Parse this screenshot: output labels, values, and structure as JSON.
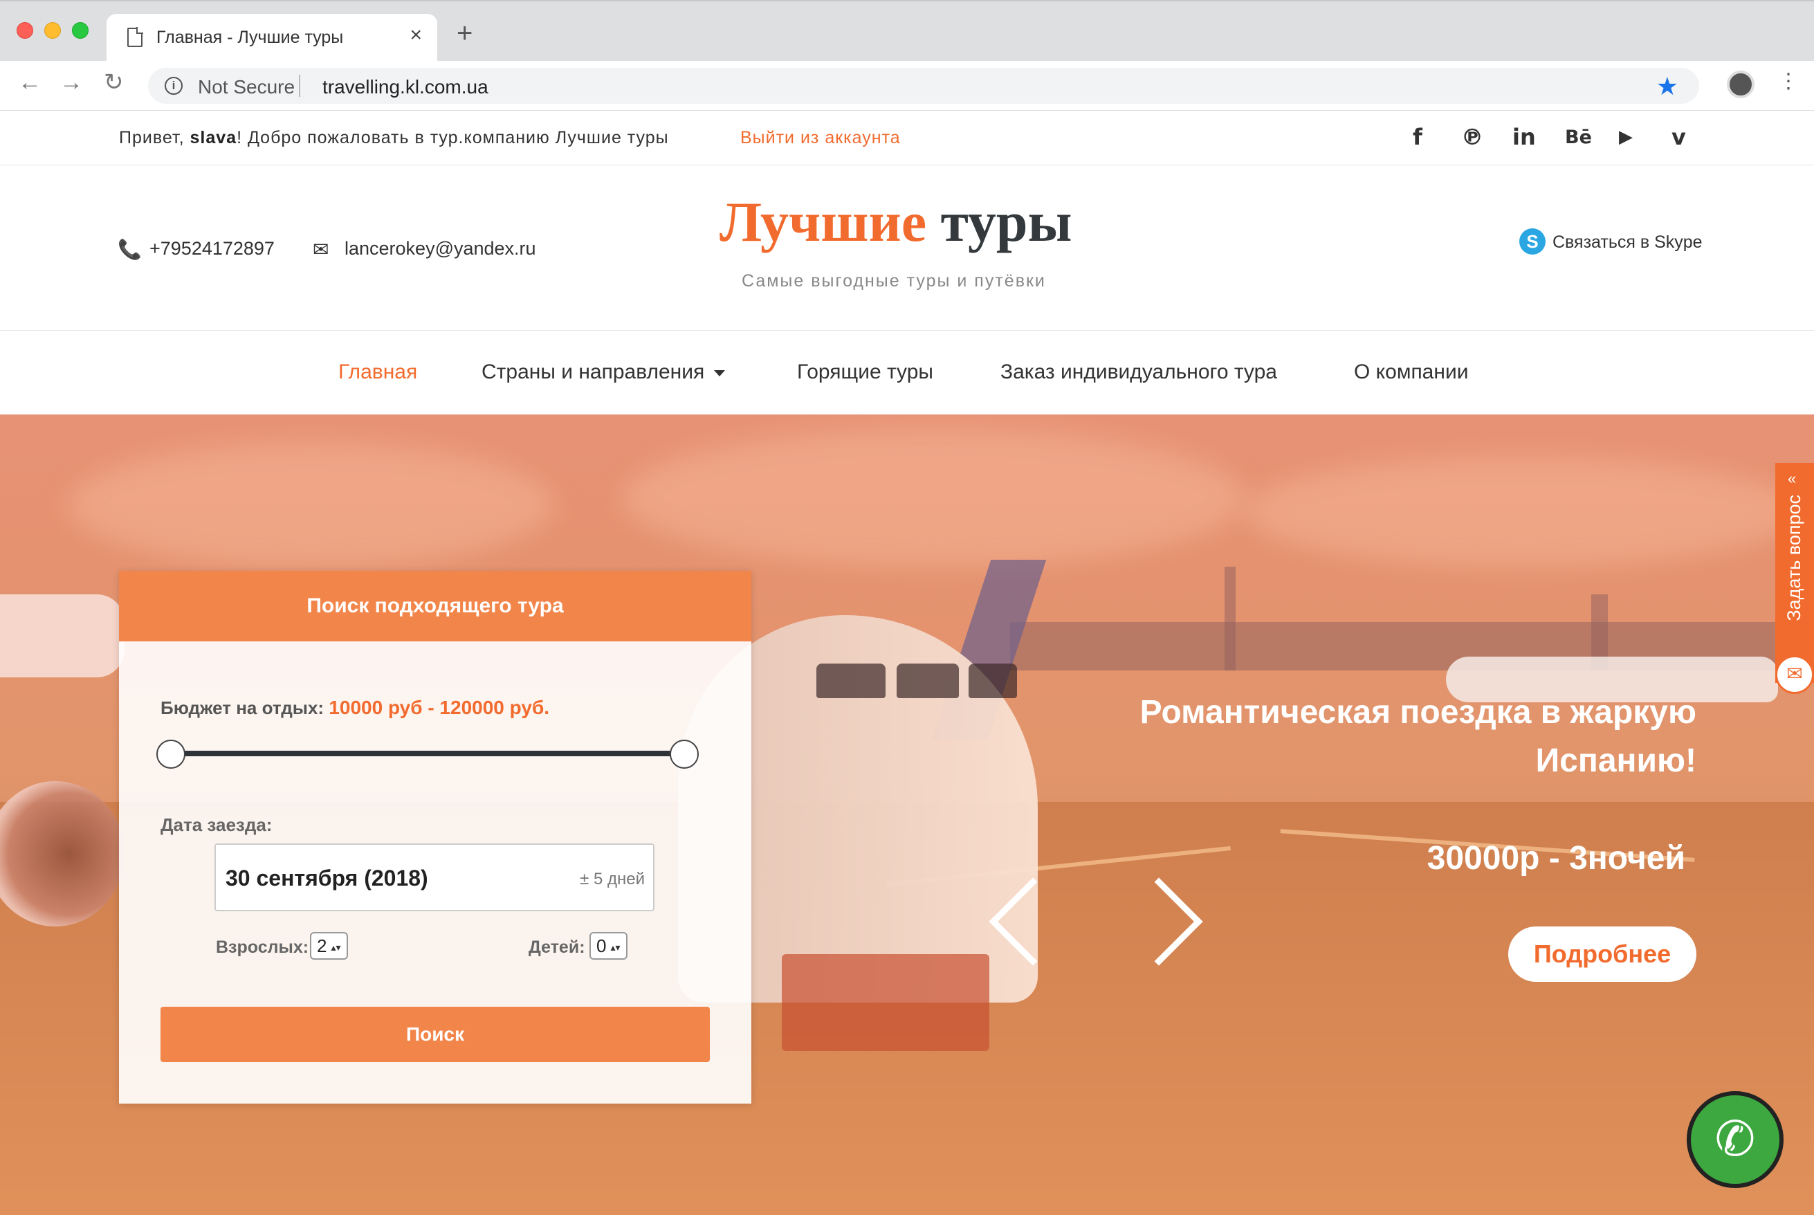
{
  "browser": {
    "tab_title": "Главная - Лучшие туры",
    "tab_close": "×",
    "new_tab": "+",
    "back": "←",
    "forward": "→",
    "reload": "↻",
    "security_label": "Not Secure",
    "url": "travelling.kl.com.ua",
    "bookmark_star": "★",
    "menu": "⋮",
    "info": "i"
  },
  "topbar": {
    "greeting_prefix": "Привет,",
    "username": "slava",
    "greeting_suffix": "! Добро пожаловать в тур.компанию Лучшие туры",
    "logout": "Выйти из аккаунта",
    "social": [
      {
        "icon": "facebook-icon",
        "glyph": "f"
      },
      {
        "icon": "pinterest-icon",
        "glyph": "℗"
      },
      {
        "icon": "linkedin-icon",
        "glyph": "in"
      },
      {
        "icon": "behance-icon",
        "glyph": "Bē"
      },
      {
        "icon": "youtube-icon",
        "glyph": "▶"
      },
      {
        "icon": "vimeo-icon",
        "glyph": "v"
      }
    ]
  },
  "header": {
    "phone_icon": "📞",
    "phone": "+79524172897",
    "mail_icon": "✉",
    "email": "lancerokey@yandex.ru",
    "logo_part1": "Лучшие",
    "logo_part2": "туры",
    "slogan": "Самые выгодные туры и путёвки",
    "skype_icon": "S",
    "skype": "Связаться в Skype"
  },
  "nav": {
    "items": [
      {
        "label": "Главная",
        "active": true
      },
      {
        "label": "Страны и направления",
        "dropdown": true
      },
      {
        "label": "Горящие туры"
      },
      {
        "label": "Заказ индивидуального тура"
      },
      {
        "label": "О компании"
      }
    ]
  },
  "search": {
    "title": "Поиск подходящего тура",
    "budget_label": "Бюджет на отдых:",
    "budget_value": "10000 руб - 120000 руб.",
    "date_label": "Дата заезда:",
    "date_value": "30 сентября (2018)",
    "date_range": "± 5 дней",
    "adults_label": "Взрослых:",
    "adults_value": "2",
    "kids_label": "Детей:",
    "kids_value": "0",
    "spin_arrows": "▴▾",
    "button": "Поиск"
  },
  "slide": {
    "title": "Романтическая поездка в жаркую Испанию!",
    "price": "30000р - 3ночей",
    "more": "Подробнее"
  },
  "widgets": {
    "ask": "Задать вопрос",
    "ask_chevron": "«",
    "mail_icon": "✉",
    "call_icon": "✆"
  },
  "colors": {
    "accent": "#f26b2e",
    "panel_head": "#f2854a",
    "call": "#3ca83f"
  }
}
